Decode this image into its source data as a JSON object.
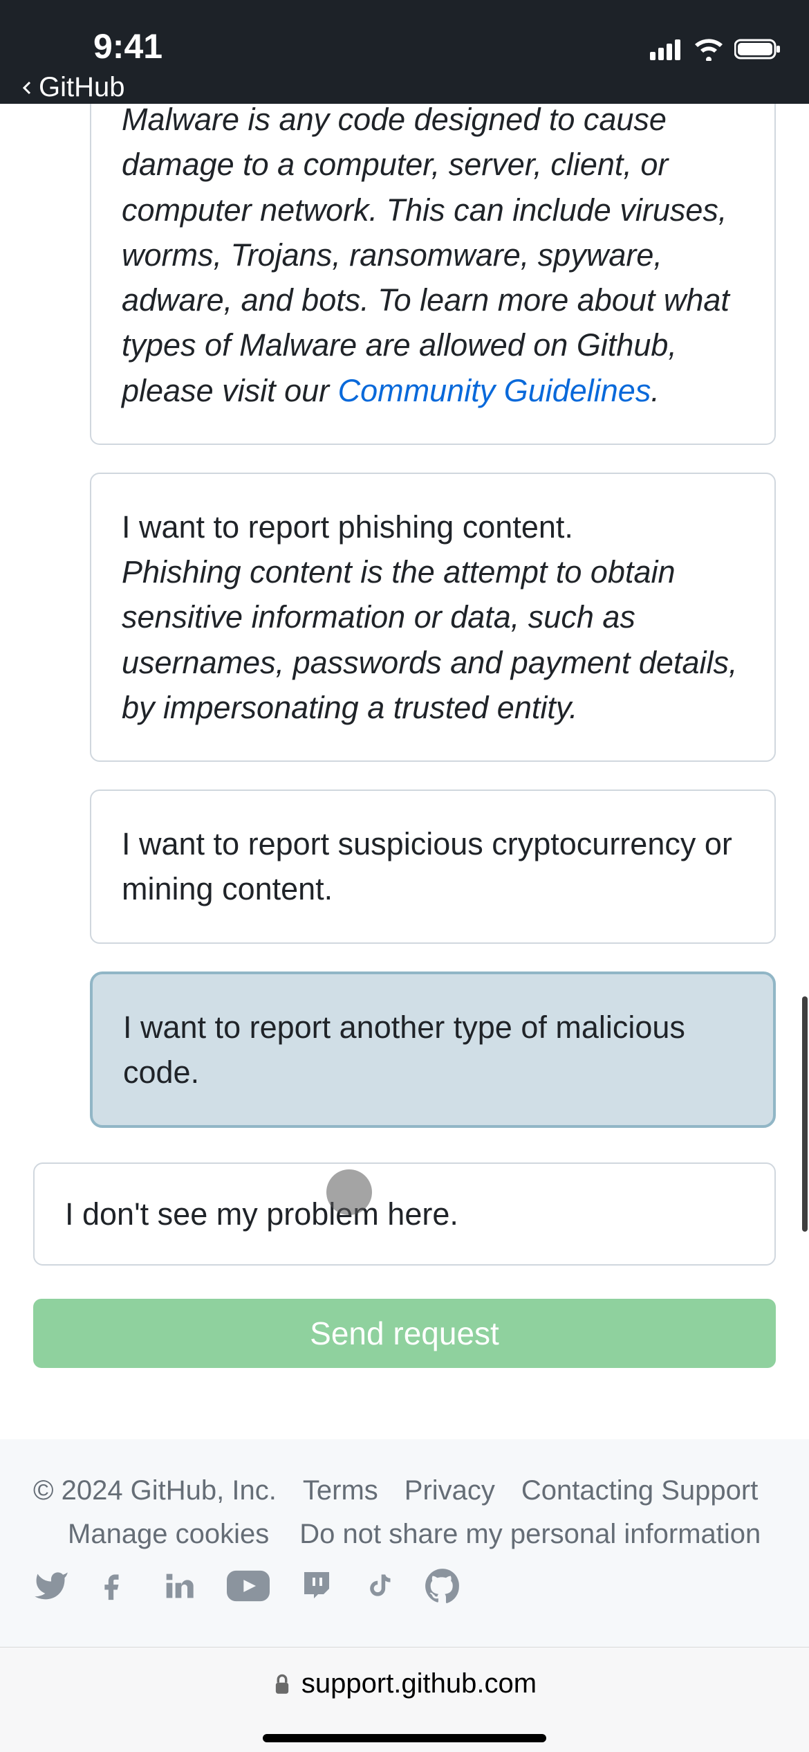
{
  "status": {
    "time": "9:41",
    "back_app": "GitHub"
  },
  "options": {
    "malware": {
      "desc_prefix": "Malware is any code designed to cause damage to a computer, server, client, or computer network. This can include viruses, worms, Trojans, ransomware, spyware, adware, and bots. To learn more about what types of Malware are allowed on Github, please visit our ",
      "link_text": "Community Guidelines",
      "desc_suffix": "."
    },
    "phishing": {
      "title": "I want to report phishing content.",
      "desc": "Phishing content is the attempt to obtain sensitive information or data, such as usernames, passwords and payment details, by impersonating a trusted entity."
    },
    "crypto": {
      "title": "I want to report suspicious cryptocurrency or mining content."
    },
    "other_malicious": {
      "title": "I want to report another type of malicious code."
    },
    "none": {
      "title": "I don't see my problem here."
    }
  },
  "send_button": "Send request",
  "footer": {
    "copyright": "© 2024 GitHub, Inc.",
    "terms": "Terms",
    "privacy": "Privacy",
    "contact": "Contacting Support",
    "cookies": "Manage cookies",
    "dns": "Do not share my personal information"
  },
  "urlbar": {
    "domain": "support.github.com"
  }
}
